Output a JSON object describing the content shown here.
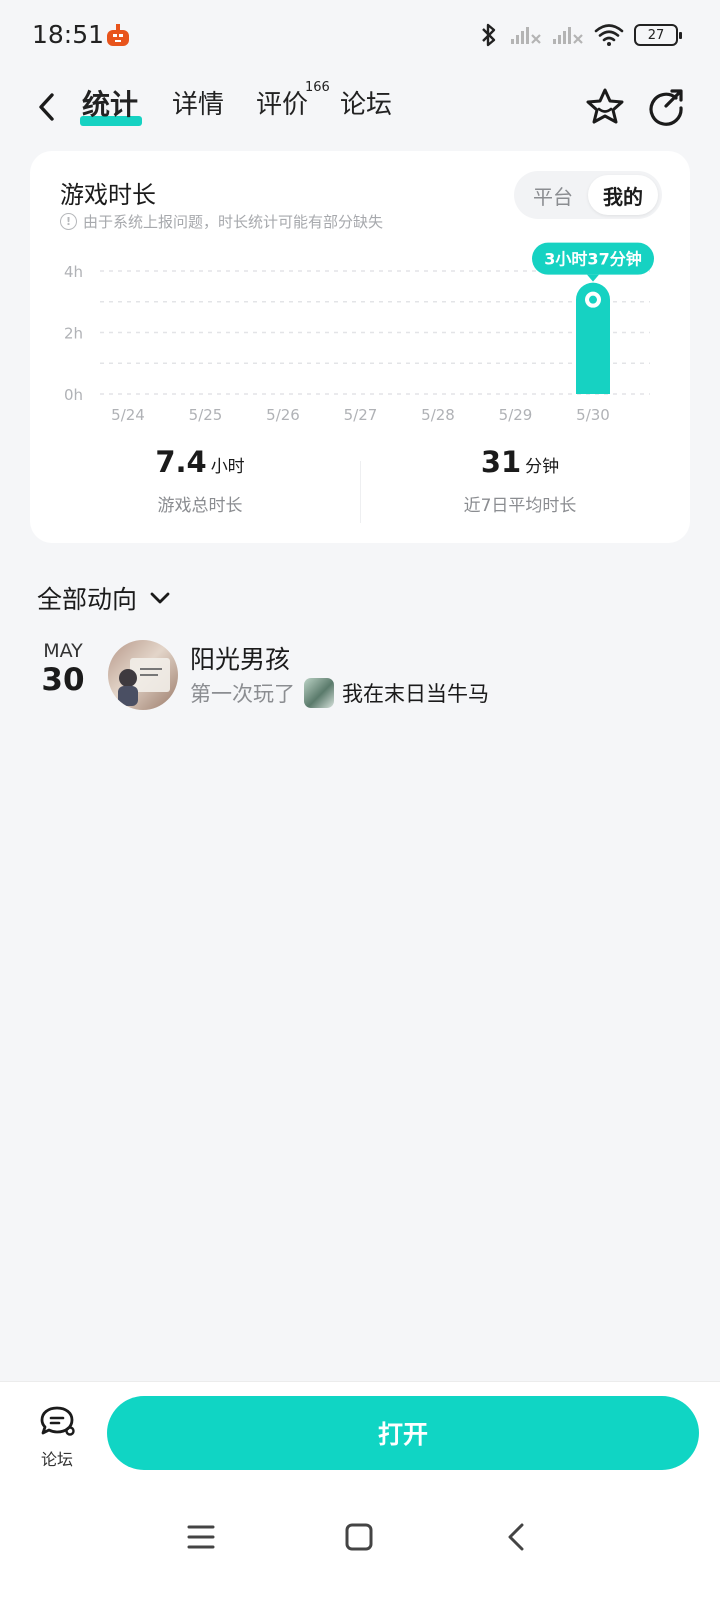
{
  "status_bar": {
    "time": "18:51",
    "battery": "27",
    "icons": [
      "bluetooth-icon",
      "signal-1-icon",
      "signal-2-icon",
      "wifi-icon",
      "battery-icon"
    ]
  },
  "nav": {
    "tabs": [
      {
        "label": "统计",
        "active": true
      },
      {
        "label": "详情",
        "active": false
      },
      {
        "label": "评价",
        "active": false,
        "badge": "166"
      },
      {
        "label": "论坛",
        "active": false
      }
    ],
    "icons": [
      "back-icon",
      "star-icon",
      "share-icon"
    ]
  },
  "playtime_card": {
    "title": "游戏时长",
    "notice": "由于系统上报问题，时长统计可能有部分缺失",
    "segments": [
      "平台",
      "我的"
    ],
    "selected_segment": "我的",
    "total": {
      "value": "7.4",
      "unit": "小时",
      "label": "游戏总时长"
    },
    "average": {
      "value": "31",
      "unit": "分钟",
      "label": "近7日平均时长"
    }
  },
  "chart_data": {
    "type": "bar",
    "categories": [
      "5/24",
      "5/25",
      "5/26",
      "5/27",
      "5/28",
      "5/29",
      "5/30"
    ],
    "values": [
      0,
      0,
      0,
      0,
      0,
      0,
      3.62
    ],
    "y_ticks": [
      "0h",
      "2h",
      "4h"
    ],
    "ylim": [
      0,
      4
    ],
    "grid": true,
    "tooltip": "3小时37分钟",
    "highlight_color": "#16d2c2"
  },
  "activity": {
    "header": "全部动向",
    "items": [
      {
        "month": "MAY",
        "day": "30",
        "user": "阳光男孩",
        "verb": "第一次玩了",
        "game": "我在末日当牛马"
      }
    ]
  },
  "bottom_bar": {
    "forum_label": "论坛",
    "open_label": "打开"
  },
  "colors": {
    "accent": "#10d5c4",
    "background": "#f5f6f8"
  }
}
